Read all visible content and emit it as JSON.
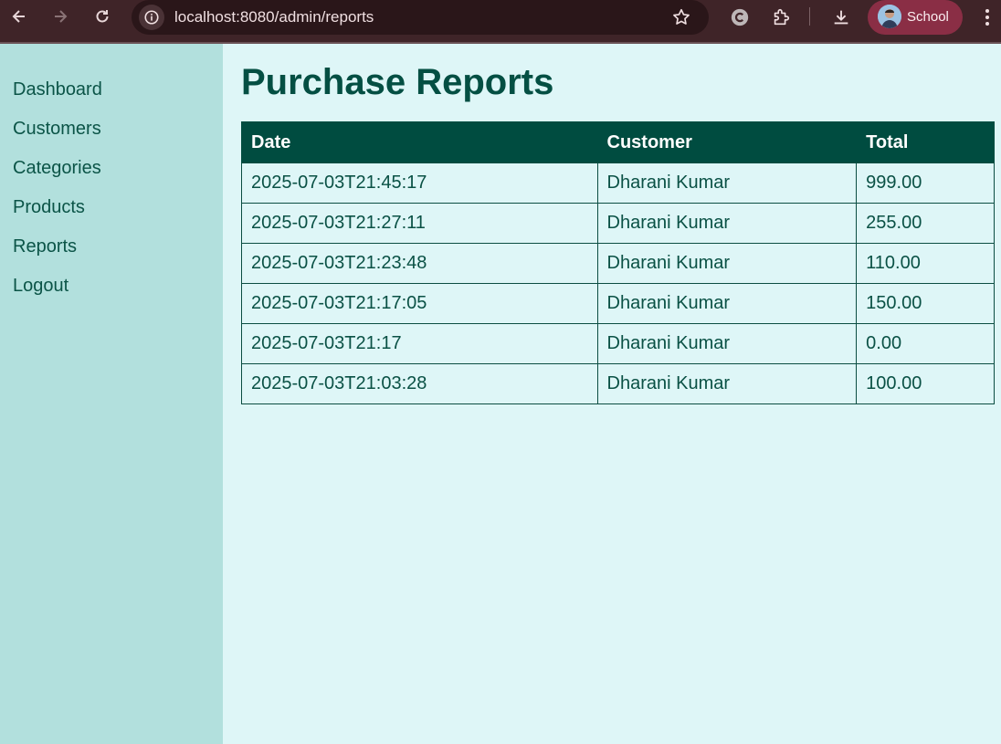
{
  "browser": {
    "url": "localhost:8080/admin/reports",
    "profile_label": "School"
  },
  "sidebar": {
    "items": [
      {
        "label": "Dashboard"
      },
      {
        "label": "Customers"
      },
      {
        "label": "Categories"
      },
      {
        "label": "Products"
      },
      {
        "label": "Reports"
      },
      {
        "label": "Logout"
      }
    ]
  },
  "main": {
    "title": "Purchase Reports",
    "table": {
      "headers": [
        "Date",
        "Customer",
        "Total"
      ],
      "rows": [
        [
          "2025-07-03T21:45:17",
          "Dharani Kumar",
          "999.00"
        ],
        [
          "2025-07-03T21:27:11",
          "Dharani Kumar",
          "255.00"
        ],
        [
          "2025-07-03T21:23:48",
          "Dharani Kumar",
          "110.00"
        ],
        [
          "2025-07-03T21:17:05",
          "Dharani Kumar",
          "150.00"
        ],
        [
          "2025-07-03T21:17",
          "Dharani Kumar",
          "0.00"
        ],
        [
          "2025-07-03T21:03:28",
          "Dharani Kumar",
          "100.00"
        ]
      ]
    }
  },
  "colors": {
    "sidebar_bg": "#b2e0dd",
    "main_bg": "#def6f7",
    "header_bg": "#004c40",
    "text": "#0a5145",
    "browser_frame": "#3f2428"
  }
}
